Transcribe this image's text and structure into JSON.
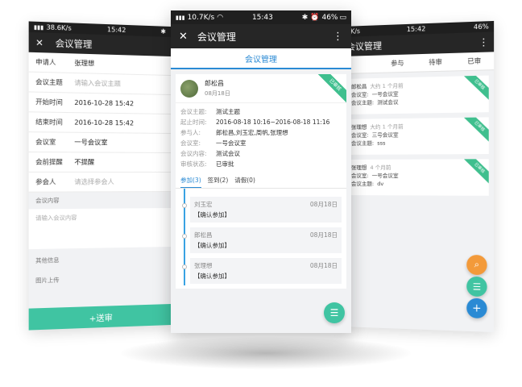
{
  "left": {
    "status": {
      "signal": "38.6K/s",
      "time": "15:42"
    },
    "title": "会议管理",
    "rows": [
      {
        "label": "申请人",
        "value": "张理想",
        "placeholder": ""
      },
      {
        "label": "会议主题",
        "value": "",
        "placeholder": "请输入会议主题"
      },
      {
        "label": "开始时间",
        "value": "2016-10-28 15:42",
        "placeholder": ""
      },
      {
        "label": "结束时间",
        "value": "2016-10-28 15:42",
        "placeholder": ""
      },
      {
        "label": "会议室",
        "value": "一号会议室",
        "placeholder": ""
      },
      {
        "label": "会前提醒",
        "value": "不提醒",
        "placeholder": ""
      },
      {
        "label": "参会人",
        "value": "",
        "placeholder": "请选择参会人"
      }
    ],
    "content_label": "会议内容",
    "content_placeholder": "请输入会议内容",
    "other_info": "其他信息",
    "upload": "图片上传",
    "submit": "+送审"
  },
  "center": {
    "status": {
      "signal": "10.7K/s",
      "time": "15:43",
      "battery": "46%"
    },
    "title": "会议管理",
    "subheader": "会议管理",
    "card": {
      "name": "郎松昌",
      "date": "08月18日",
      "ribbon": "已审核",
      "fields": [
        {
          "k": "会议主题:",
          "v": "测试主题"
        },
        {
          "k": "起止时间:",
          "v": "2016-08-18 10:16~2016-08-18 11:16"
        },
        {
          "k": "参与人:",
          "v": "郎松昌,刘玉宏,周帆,张理想"
        },
        {
          "k": "会议室:",
          "v": "一号会议室"
        },
        {
          "k": "会议内容:",
          "v": "测试会议"
        },
        {
          "k": "审核状态:",
          "v": "已审批"
        }
      ],
      "tabs": [
        "参加(3)",
        "签到(2)",
        "请假(0)"
      ],
      "timeline": [
        {
          "name": "刘玉宏",
          "date": "08月18日",
          "action": "【确认参加】"
        },
        {
          "name": "郎松昌",
          "date": "08月18日",
          "action": "【确认参加】"
        },
        {
          "name": "张理想",
          "date": "08月18日",
          "action": "【确认参加】"
        }
      ]
    }
  },
  "right": {
    "status": {
      "signal": "3K/s",
      "time": "15:42",
      "battery": "46%"
    },
    "title": "会议管理",
    "tabs": [
      "",
      "参与",
      "待审",
      "已审"
    ],
    "items": [
      {
        "name": "郎松昌",
        "ago": "大约 1 个月前",
        "room_label": "会议室:",
        "room": "一号会议室",
        "topic_label": "会议主题:",
        "topic": "测试会议",
        "ribbon": "已审核"
      },
      {
        "name": "张理想",
        "ago": "大约 1 个月前",
        "room_label": "会议室:",
        "room": "三号会议室",
        "topic_label": "会议主题:",
        "topic": "sss",
        "ribbon": "已审核"
      },
      {
        "name": "张理想",
        "ago": "4 个月前",
        "room_label": "会议室:",
        "room": "一号会议室",
        "topic_label": "会议主题:",
        "topic": "dv",
        "ribbon": "已审核"
      }
    ],
    "fab_colors": [
      "#f39a3a",
      "#40c4a2",
      "#2a8ad4"
    ]
  }
}
